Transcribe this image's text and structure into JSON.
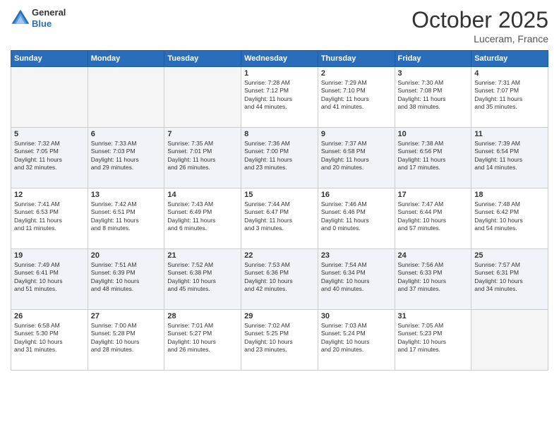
{
  "header": {
    "logo_general": "General",
    "logo_blue": "Blue",
    "month": "October 2025",
    "location": "Luceram, France"
  },
  "days_of_week": [
    "Sunday",
    "Monday",
    "Tuesday",
    "Wednesday",
    "Thursday",
    "Friday",
    "Saturday"
  ],
  "weeks": [
    [
      {
        "day": "",
        "info": ""
      },
      {
        "day": "",
        "info": ""
      },
      {
        "day": "",
        "info": ""
      },
      {
        "day": "1",
        "info": "Sunrise: 7:28 AM\nSunset: 7:12 PM\nDaylight: 11 hours\nand 44 minutes."
      },
      {
        "day": "2",
        "info": "Sunrise: 7:29 AM\nSunset: 7:10 PM\nDaylight: 11 hours\nand 41 minutes."
      },
      {
        "day": "3",
        "info": "Sunrise: 7:30 AM\nSunset: 7:08 PM\nDaylight: 11 hours\nand 38 minutes."
      },
      {
        "day": "4",
        "info": "Sunrise: 7:31 AM\nSunset: 7:07 PM\nDaylight: 11 hours\nand 35 minutes."
      }
    ],
    [
      {
        "day": "5",
        "info": "Sunrise: 7:32 AM\nSunset: 7:05 PM\nDaylight: 11 hours\nand 32 minutes."
      },
      {
        "day": "6",
        "info": "Sunrise: 7:33 AM\nSunset: 7:03 PM\nDaylight: 11 hours\nand 29 minutes."
      },
      {
        "day": "7",
        "info": "Sunrise: 7:35 AM\nSunset: 7:01 PM\nDaylight: 11 hours\nand 26 minutes."
      },
      {
        "day": "8",
        "info": "Sunrise: 7:36 AM\nSunset: 7:00 PM\nDaylight: 11 hours\nand 23 minutes."
      },
      {
        "day": "9",
        "info": "Sunrise: 7:37 AM\nSunset: 6:58 PM\nDaylight: 11 hours\nand 20 minutes."
      },
      {
        "day": "10",
        "info": "Sunrise: 7:38 AM\nSunset: 6:56 PM\nDaylight: 11 hours\nand 17 minutes."
      },
      {
        "day": "11",
        "info": "Sunrise: 7:39 AM\nSunset: 6:54 PM\nDaylight: 11 hours\nand 14 minutes."
      }
    ],
    [
      {
        "day": "12",
        "info": "Sunrise: 7:41 AM\nSunset: 6:53 PM\nDaylight: 11 hours\nand 11 minutes."
      },
      {
        "day": "13",
        "info": "Sunrise: 7:42 AM\nSunset: 6:51 PM\nDaylight: 11 hours\nand 8 minutes."
      },
      {
        "day": "14",
        "info": "Sunrise: 7:43 AM\nSunset: 6:49 PM\nDaylight: 11 hours\nand 6 minutes."
      },
      {
        "day": "15",
        "info": "Sunrise: 7:44 AM\nSunset: 6:47 PM\nDaylight: 11 hours\nand 3 minutes."
      },
      {
        "day": "16",
        "info": "Sunrise: 7:46 AM\nSunset: 6:46 PM\nDaylight: 11 hours\nand 0 minutes."
      },
      {
        "day": "17",
        "info": "Sunrise: 7:47 AM\nSunset: 6:44 PM\nDaylight: 10 hours\nand 57 minutes."
      },
      {
        "day": "18",
        "info": "Sunrise: 7:48 AM\nSunset: 6:42 PM\nDaylight: 10 hours\nand 54 minutes."
      }
    ],
    [
      {
        "day": "19",
        "info": "Sunrise: 7:49 AM\nSunset: 6:41 PM\nDaylight: 10 hours\nand 51 minutes."
      },
      {
        "day": "20",
        "info": "Sunrise: 7:51 AM\nSunset: 6:39 PM\nDaylight: 10 hours\nand 48 minutes."
      },
      {
        "day": "21",
        "info": "Sunrise: 7:52 AM\nSunset: 6:38 PM\nDaylight: 10 hours\nand 45 minutes."
      },
      {
        "day": "22",
        "info": "Sunrise: 7:53 AM\nSunset: 6:36 PM\nDaylight: 10 hours\nand 42 minutes."
      },
      {
        "day": "23",
        "info": "Sunrise: 7:54 AM\nSunset: 6:34 PM\nDaylight: 10 hours\nand 40 minutes."
      },
      {
        "day": "24",
        "info": "Sunrise: 7:56 AM\nSunset: 6:33 PM\nDaylight: 10 hours\nand 37 minutes."
      },
      {
        "day": "25",
        "info": "Sunrise: 7:57 AM\nSunset: 6:31 PM\nDaylight: 10 hours\nand 34 minutes."
      }
    ],
    [
      {
        "day": "26",
        "info": "Sunrise: 6:58 AM\nSunset: 5:30 PM\nDaylight: 10 hours\nand 31 minutes."
      },
      {
        "day": "27",
        "info": "Sunrise: 7:00 AM\nSunset: 5:28 PM\nDaylight: 10 hours\nand 28 minutes."
      },
      {
        "day": "28",
        "info": "Sunrise: 7:01 AM\nSunset: 5:27 PM\nDaylight: 10 hours\nand 26 minutes."
      },
      {
        "day": "29",
        "info": "Sunrise: 7:02 AM\nSunset: 5:25 PM\nDaylight: 10 hours\nand 23 minutes."
      },
      {
        "day": "30",
        "info": "Sunrise: 7:03 AM\nSunset: 5:24 PM\nDaylight: 10 hours\nand 20 minutes."
      },
      {
        "day": "31",
        "info": "Sunrise: 7:05 AM\nSunset: 5:23 PM\nDaylight: 10 hours\nand 17 minutes."
      },
      {
        "day": "",
        "info": ""
      }
    ]
  ]
}
